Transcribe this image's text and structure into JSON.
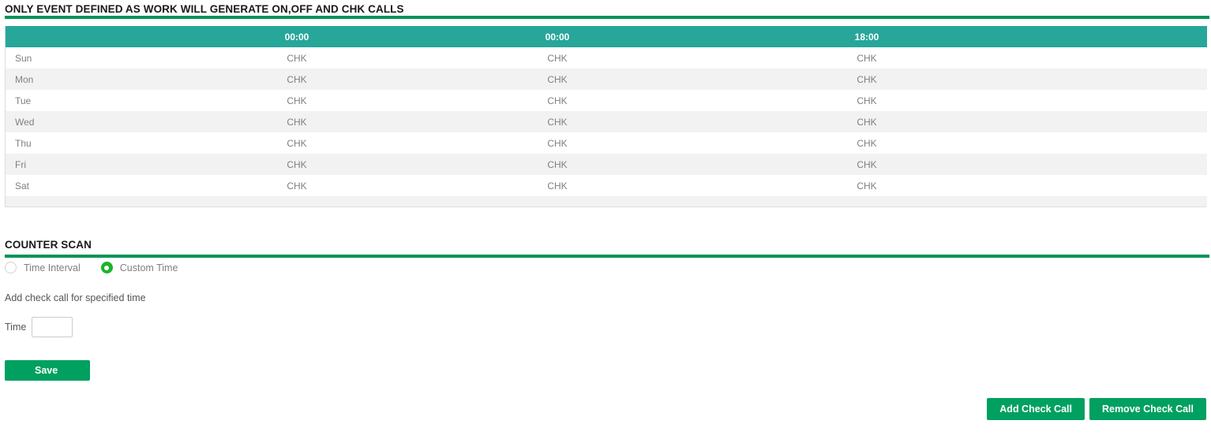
{
  "work_section": {
    "title": "ONLY EVENT DEFINED AS WORK WILL GENERATE ON,OFF AND CHK CALLS",
    "table": {
      "headers": [
        "",
        "00:00",
        "00:00",
        "18:00"
      ],
      "rows": [
        {
          "day": "Sun",
          "values": [
            "CHK",
            "CHK",
            "CHK"
          ]
        },
        {
          "day": "Mon",
          "values": [
            "CHK",
            "CHK",
            "CHK"
          ]
        },
        {
          "day": "Tue",
          "values": [
            "CHK",
            "CHK",
            "CHK"
          ]
        },
        {
          "day": "Wed",
          "values": [
            "CHK",
            "CHK",
            "CHK"
          ]
        },
        {
          "day": "Thu",
          "values": [
            "CHK",
            "CHK",
            "CHK"
          ]
        },
        {
          "day": "Fri",
          "values": [
            "CHK",
            "CHK",
            "CHK"
          ]
        },
        {
          "day": "Sat",
          "values": [
            "CHK",
            "CHK",
            "CHK"
          ]
        }
      ]
    }
  },
  "counter_scan": {
    "title": "COUNTER SCAN",
    "mode_options": [
      {
        "label": "Time Interval",
        "selected": false
      },
      {
        "label": "Custom Time",
        "selected": true
      }
    ],
    "helper_text": "Add check call for specified time",
    "time_field": {
      "label": "Time",
      "value": "",
      "placeholder": ""
    },
    "save_label": "Save"
  },
  "footer_actions": {
    "add_check_call": "Add Check Call",
    "remove_check_call": "Remove Check Call"
  },
  "colors": {
    "rule_green": "#009457",
    "table_header_teal": "#27a69a",
    "button_green": "#00a060",
    "radio_selected_green": "#19b52a",
    "row_stripe": "#f2f2f2",
    "text_gray": "#808080"
  }
}
